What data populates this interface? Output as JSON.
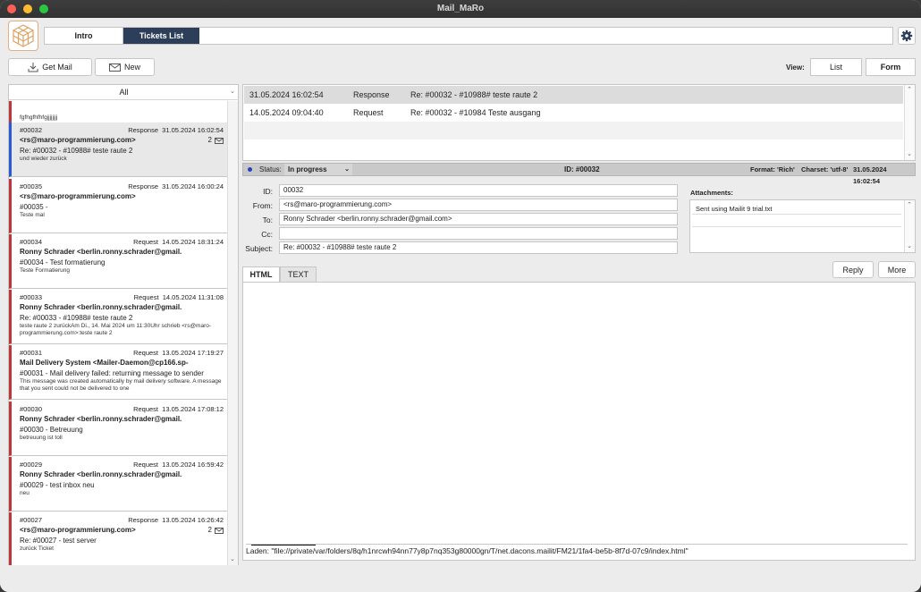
{
  "window": {
    "title": "Mail_MaRo"
  },
  "tabs": [
    {
      "label": "Intro"
    },
    {
      "label": "Tickets List"
    }
  ],
  "toolbar": {
    "get_mail": "Get Mail",
    "new": "New",
    "view_label": "View:",
    "view_list": "List",
    "view_form": "Form"
  },
  "filter": {
    "selected": "All"
  },
  "messages": [
    {
      "num": "",
      "type": "",
      "date": "",
      "from": "",
      "subject": "",
      "preview": "fgfhgfhfhfgjjjjjjjj",
      "count": "",
      "color": "#c0343c"
    },
    {
      "num": "#00032",
      "type": "Response",
      "date": "31.05.2024 16:02:54",
      "from": "<rs@maro-programmierung.com>",
      "subject": "Re: #00032 -  #10988# teste raute 2",
      "preview": "und wieder zurück",
      "count": "2",
      "color": "#2a5bd7"
    },
    {
      "num": "#00035",
      "type": "Response",
      "date": "31.05.2024 16:00:24",
      "from": "<rs@maro-programmierung.com>",
      "subject": "#00035 -",
      "preview": "Teste mal",
      "count": "",
      "color": "#c0343c"
    },
    {
      "num": "#00034",
      "type": "Request",
      "date": "14.05.2024 18:31:24",
      "from": "Ronny Schrader <berlin.ronny.schrader@gmail.",
      "subject": "#00034 - Test formatierung",
      "preview": "Teste Formatierung",
      "count": "",
      "color": "#c0343c"
    },
    {
      "num": "#00033",
      "type": "Request",
      "date": "14.05.2024 11:31:08",
      "from": "Ronny Schrader <berlin.ronny.schrader@gmail.",
      "subject": "Re: #00033 -  #10988# teste raute 2",
      "preview": "teste raute 2 zurückAm Di., 14. Mai 2024 um 11:30Uhr schrieb <rs@maro-programmierung.com>:teste raute 2",
      "count": "",
      "color": "#c0343c"
    },
    {
      "num": "#00031",
      "type": "Request",
      "date": "13.05.2024 17:19:27",
      "from": "Mail Delivery System <Mailer-Daemon@cp166.sp-",
      "subject": "#00031 - Mail delivery failed: returning message to sender",
      "preview": "This message was created automatically by mail delivery software.  A message that you sent could not be delivered to one",
      "count": "",
      "color": "#c0343c"
    },
    {
      "num": "#00030",
      "type": "Request",
      "date": "13.05.2024 17:08:12",
      "from": "Ronny Schrader <berlin.ronny.schrader@gmail.",
      "subject": "#00030 - Betreuung",
      "preview": "betreuung ist toll",
      "count": "",
      "color": "#c0343c"
    },
    {
      "num": "#00029",
      "type": "Request",
      "date": "13.05.2024 16:59:42",
      "from": "Ronny Schrader <berlin.ronny.schrader@gmail.",
      "subject": "#00029 - test inbox neu",
      "preview": "neu",
      "count": "",
      "color": "#c0343c"
    },
    {
      "num": "#00027",
      "type": "Response",
      "date": "13.05.2024 16:26:42",
      "from": "<rs@maro-programmierung.com>",
      "subject": "Re: #00027 - test server",
      "preview": "zurück Ticket",
      "count": "2",
      "color": "#c0343c"
    }
  ],
  "ticket_rows": [
    {
      "date": "31.05.2024 16:02:54",
      "type": "Response",
      "subject": "Re: #00032 -  #10988# teste raute 2"
    },
    {
      "date": "14.05.2024 09:04:40",
      "type": "Request",
      "subject": "Re: #00032 -  #10984 Teste ausgang"
    }
  ],
  "status": {
    "label": "Status:",
    "value": "In progress",
    "id": "ID: #00032",
    "format": "Format: 'Rich'",
    "charset": "Charset: 'utf-8'",
    "date": "31.05.2024 16:02:54"
  },
  "form": {
    "id_label": "ID:",
    "id": "00032",
    "from_label": "From:",
    "from": "<rs@maro-programmierung.com>",
    "to_label": "To:",
    "to": "Ronny Schrader <berlin.ronny.schrader@gmail.com>",
    "cc_label": "Cc:",
    "cc": "",
    "subject_label": "Subject:",
    "subject": "Re: #00032 -  #10988# teste raute 2"
  },
  "attachments": {
    "label": "Attachments:",
    "items": [
      "Sent using Mailit 9 trial.txt"
    ]
  },
  "body_tabs": {
    "html": "HTML",
    "text": "TEXT",
    "reply": "Reply",
    "more": "More"
  },
  "loading": "Laden: \"file://private/var/folders/8q/h1nrcwh94nn77y8p7nq353g80000gn/T/net.dacons.mailit/FM21/1fa4-be5b-8f7d-07c9/index.html\""
}
